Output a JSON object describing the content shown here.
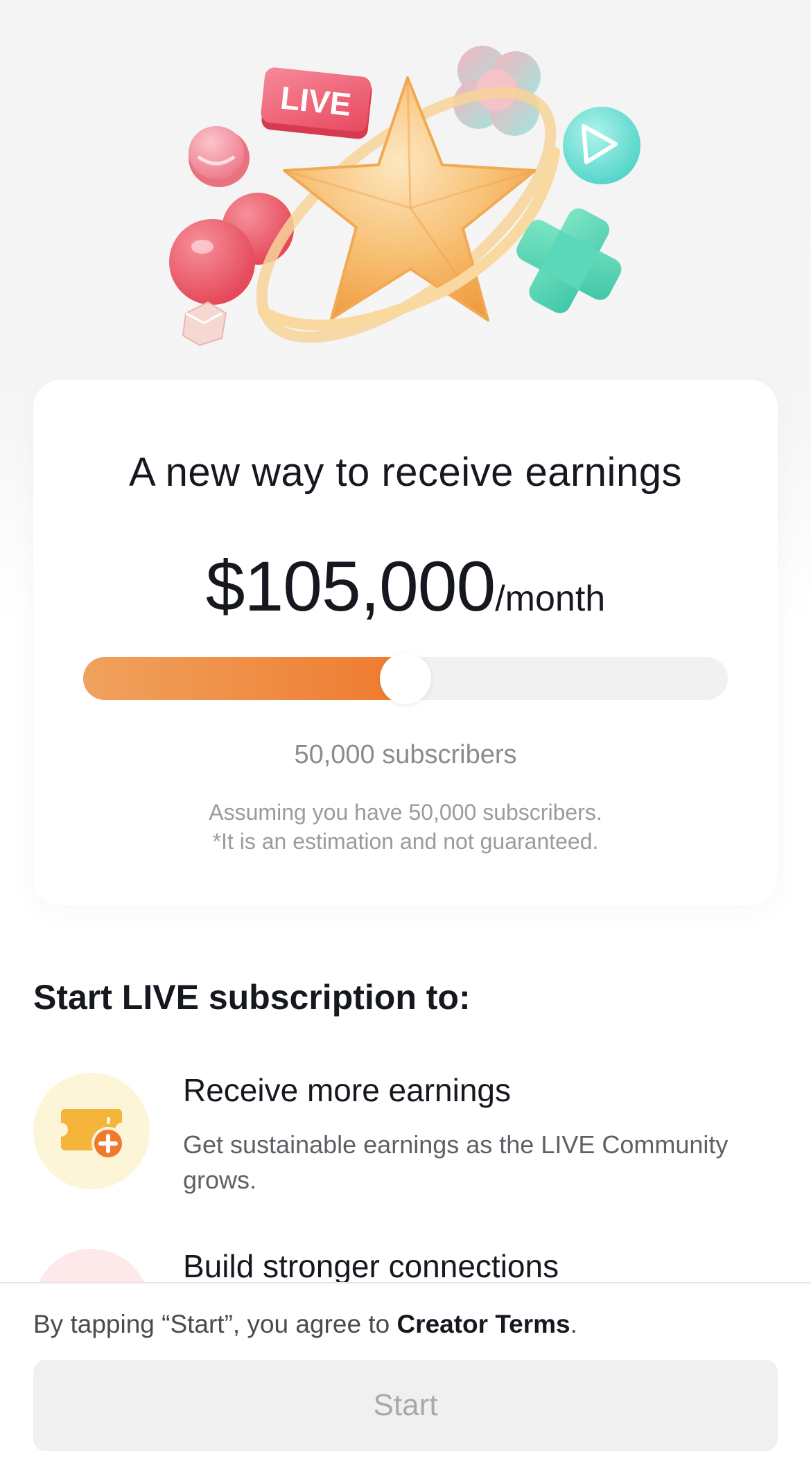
{
  "hero": {
    "badge_text": "LIVE"
  },
  "card": {
    "title": "A new way to receive earnings",
    "amount": "$105,000",
    "period": "/month",
    "slider_fraction": 0.5,
    "subscribers_label": "50,000 subscribers",
    "note_line1": "Assuming you have 50,000 subscribers.",
    "note_line2": "*It is an estimation and not guaranteed."
  },
  "section": {
    "title": "Start LIVE subscription to:",
    "benefits": [
      {
        "icon": "ticket-plus-icon",
        "title": "Receive more earnings",
        "description": "Get sustainable earnings as the LIVE Community grows."
      },
      {
        "icon": "heart-icon",
        "title": "Build stronger connections"
      }
    ]
  },
  "footer": {
    "terms_prefix": "By tapping “Start”, you agree to ",
    "terms_link": "Creator Terms",
    "terms_suffix": ".",
    "start_label": "Start"
  },
  "colors": {
    "accent_orange": "#ef7a2e",
    "accent_orange_light": "#f0a25e",
    "button_disabled_bg": "#f0f0f0",
    "button_disabled_text": "#a9a9ad"
  }
}
